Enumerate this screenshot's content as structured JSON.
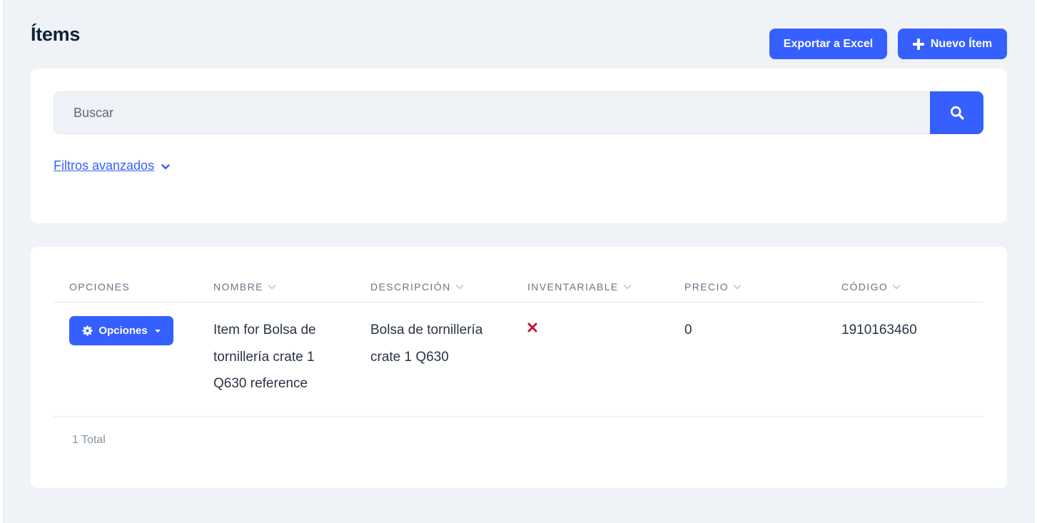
{
  "page": {
    "title": "Ítems"
  },
  "toolbar": {
    "export_label": "Exportar a Excel",
    "new_label": "Nuevo Ítem"
  },
  "search": {
    "placeholder": "Buscar",
    "advanced_filters_label": "Filtros avanzados"
  },
  "table": {
    "columns": {
      "options": "OPCIONES",
      "name": "NOMBRE",
      "description": "DESCRIPCIÓN",
      "inventoriable": "INVENTARIABLE",
      "price": "PRECIO",
      "code": "CÓDIGO"
    },
    "rows": [
      {
        "options_label": "Opciones",
        "name_lines": [
          "Item for Bolsa de",
          "tornillería crate 1",
          "Q630 reference"
        ],
        "description_lines": [
          "Bolsa de tornillería",
          "crate 1 Q630"
        ],
        "inventoriable": false,
        "price": "0",
        "code": "1910163460"
      }
    ],
    "total_label": "1 Total"
  },
  "colors": {
    "accent": "#3560ff",
    "background": "#eff3f7",
    "negative": "#c4123d"
  },
  "icons": {
    "plus": "plus-icon",
    "search": "search-icon",
    "chevron": "chevron-down-icon",
    "gear": "gear-icon",
    "cross": "cross-icon"
  }
}
